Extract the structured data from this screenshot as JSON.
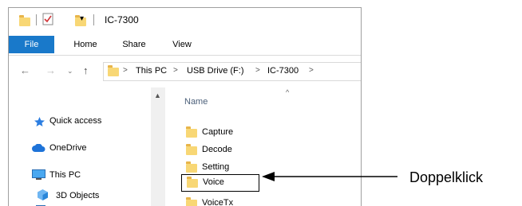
{
  "window": {
    "title": "IC-7300",
    "ribbon_tabs": [
      "File",
      "Home",
      "Share",
      "View"
    ],
    "address": {
      "separator": ">",
      "crumbs": [
        "This PC",
        "USB Drive (F:)",
        "IC-7300"
      ]
    },
    "nav_pane": {
      "items": [
        "Quick access",
        "OneDrive",
        "This PC",
        "3D Objects"
      ]
    },
    "file_list": {
      "column_header": "Name",
      "items": [
        "Capture",
        "Decode",
        "Setting",
        "Voice",
        "VoiceTx"
      ],
      "highlighted": "Voice"
    }
  },
  "annotation": {
    "label": "Doppelklick",
    "color": "#000000"
  }
}
